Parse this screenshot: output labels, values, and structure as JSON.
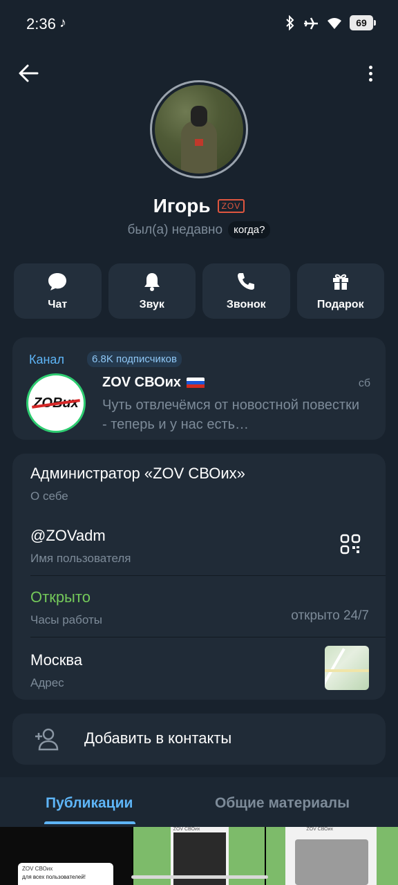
{
  "status_bar": {
    "time": "2:36",
    "note_icon": "♪",
    "battery": "69",
    "icons": [
      "bluetooth-icon",
      "airplane-icon",
      "wifi-icon",
      "battery-icon"
    ]
  },
  "profile": {
    "name": "Игорь",
    "badge": "ZOV",
    "last_seen": "был(а) недавно",
    "when_chip": "когда?"
  },
  "actions": [
    {
      "label": "Чат",
      "icon": "chat-bubble-icon"
    },
    {
      "label": "Звук",
      "icon": "bell-icon"
    },
    {
      "label": "Звонок",
      "icon": "phone-icon"
    },
    {
      "label": "Подарок",
      "icon": "gift-icon"
    }
  ],
  "channel": {
    "label": "Канал",
    "subscribers": "6.8K подписчиков",
    "title": "ZOV СВОих",
    "date": "сб",
    "preview": "Чуть отвлечёмся от новостной повестки - теперь и у нас есть…",
    "logo_text": "ZOВих"
  },
  "info": {
    "bio": {
      "value": "Администратор «ZOV СВОих»",
      "label": "О себе"
    },
    "username": {
      "value": "@ZOVadm",
      "label": "Имя пользователя"
    },
    "hours": {
      "value": "Открыто",
      "label": "Часы работы",
      "right": "открыто 24/7"
    },
    "address": {
      "value": "Москва",
      "label": "Адрес"
    }
  },
  "add_contact": {
    "label": "Добавить в контакты"
  },
  "tabs": [
    {
      "label": "Публикации",
      "active": true
    },
    {
      "label": "Общие материалы",
      "active": false
    }
  ],
  "media": {
    "cell1_line1": "ZOV СВОих",
    "cell1_line2": "для всех пользователей!",
    "cell2_header": "ZOV СВОих",
    "cell3_header": "ZOV СВОих"
  },
  "colors": {
    "background": "#18222d",
    "card": "#202b37",
    "accent": "#5eb5f7",
    "open_green": "#74c95a",
    "secondary_text": "#7d8b99"
  }
}
